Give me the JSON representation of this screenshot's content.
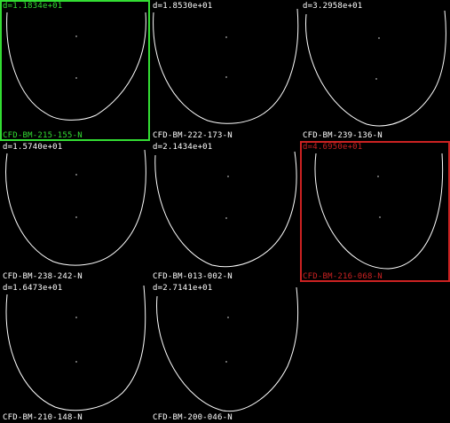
{
  "cells": [
    {
      "distance": "d=1.1834e+01",
      "id": "CFD-BM-215-155-N",
      "state": "selected-green",
      "color": "#33dd33"
    },
    {
      "distance": "d=1.8530e+01",
      "id": "CFD-BM-222-173-N",
      "state": "normal",
      "color": "#ffffff"
    },
    {
      "distance": "d=3.2958e+01",
      "id": "CFD-BM-239-136-N",
      "state": "normal",
      "color": "#ffffff"
    },
    {
      "distance": "d=1.5740e+01",
      "id": "CFD-BM-238-242-N",
      "state": "normal",
      "color": "#ffffff"
    },
    {
      "distance": "d=2.1434e+01",
      "id": "CFD-BM-013-002-N",
      "state": "normal",
      "color": "#ffffff"
    },
    {
      "distance": "d=4.6950e+01",
      "id": "CFD-BM-216-068-N",
      "state": "selected-red",
      "color": "#cc2222"
    },
    {
      "distance": "d=1.6473e+01",
      "id": "CFD-BM-210-148-N",
      "state": "normal",
      "color": "#ffffff"
    },
    {
      "distance": "d=2.7141e+01",
      "id": "CFD-BM-200-046-N",
      "state": "normal",
      "color": "#ffffff"
    }
  ]
}
